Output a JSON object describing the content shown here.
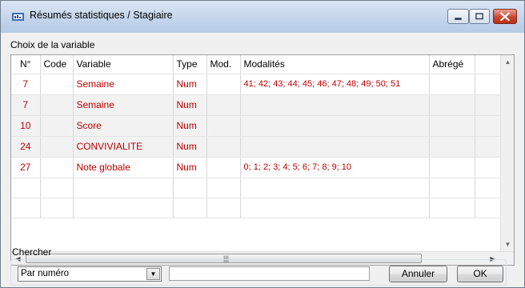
{
  "window": {
    "title": "Résumés statistiques / Stagiaire",
    "icon": "app-icon",
    "controls": [
      "minimize-icon",
      "maximize-icon",
      "close-icon"
    ]
  },
  "section": {
    "label": "Choix de la variable"
  },
  "table": {
    "headers": [
      "N°",
      "Code",
      "Variable",
      "Type",
      "Mod.",
      "Modalités",
      "Abrégé"
    ],
    "rows": [
      {
        "n": "7",
        "code": "",
        "variable": "Semaine",
        "type": "Num",
        "mod": "",
        "modalites": "41; 42; 43; 44; 45; 46; 47; 48; 49; 50; 51",
        "abrege": ""
      },
      {
        "n": "7",
        "code": "",
        "variable": "Semaine",
        "type": "Num",
        "mod": "",
        "modalites": "",
        "abrege": ""
      },
      {
        "n": "10",
        "code": "",
        "variable": "Score",
        "type": "Num",
        "mod": "",
        "modalites": "",
        "abrege": ""
      },
      {
        "n": "24",
        "code": "",
        "variable": "CONVIVIALITE",
        "type": "Num",
        "mod": "",
        "modalites": "",
        "abrege": ""
      },
      {
        "n": "27",
        "code": "",
        "variable": "Note globale",
        "type": "Num",
        "mod": "",
        "modalites": "0; 1; 2; 3; 4; 5; 6; 7; 8; 9; 10",
        "abrege": ""
      }
    ],
    "text_color": "#c00000"
  },
  "search": {
    "label": "Chercher",
    "mode_selected": "Par numéro",
    "input_value": "",
    "cancel_label": "Annuler",
    "ok_label": "OK"
  }
}
